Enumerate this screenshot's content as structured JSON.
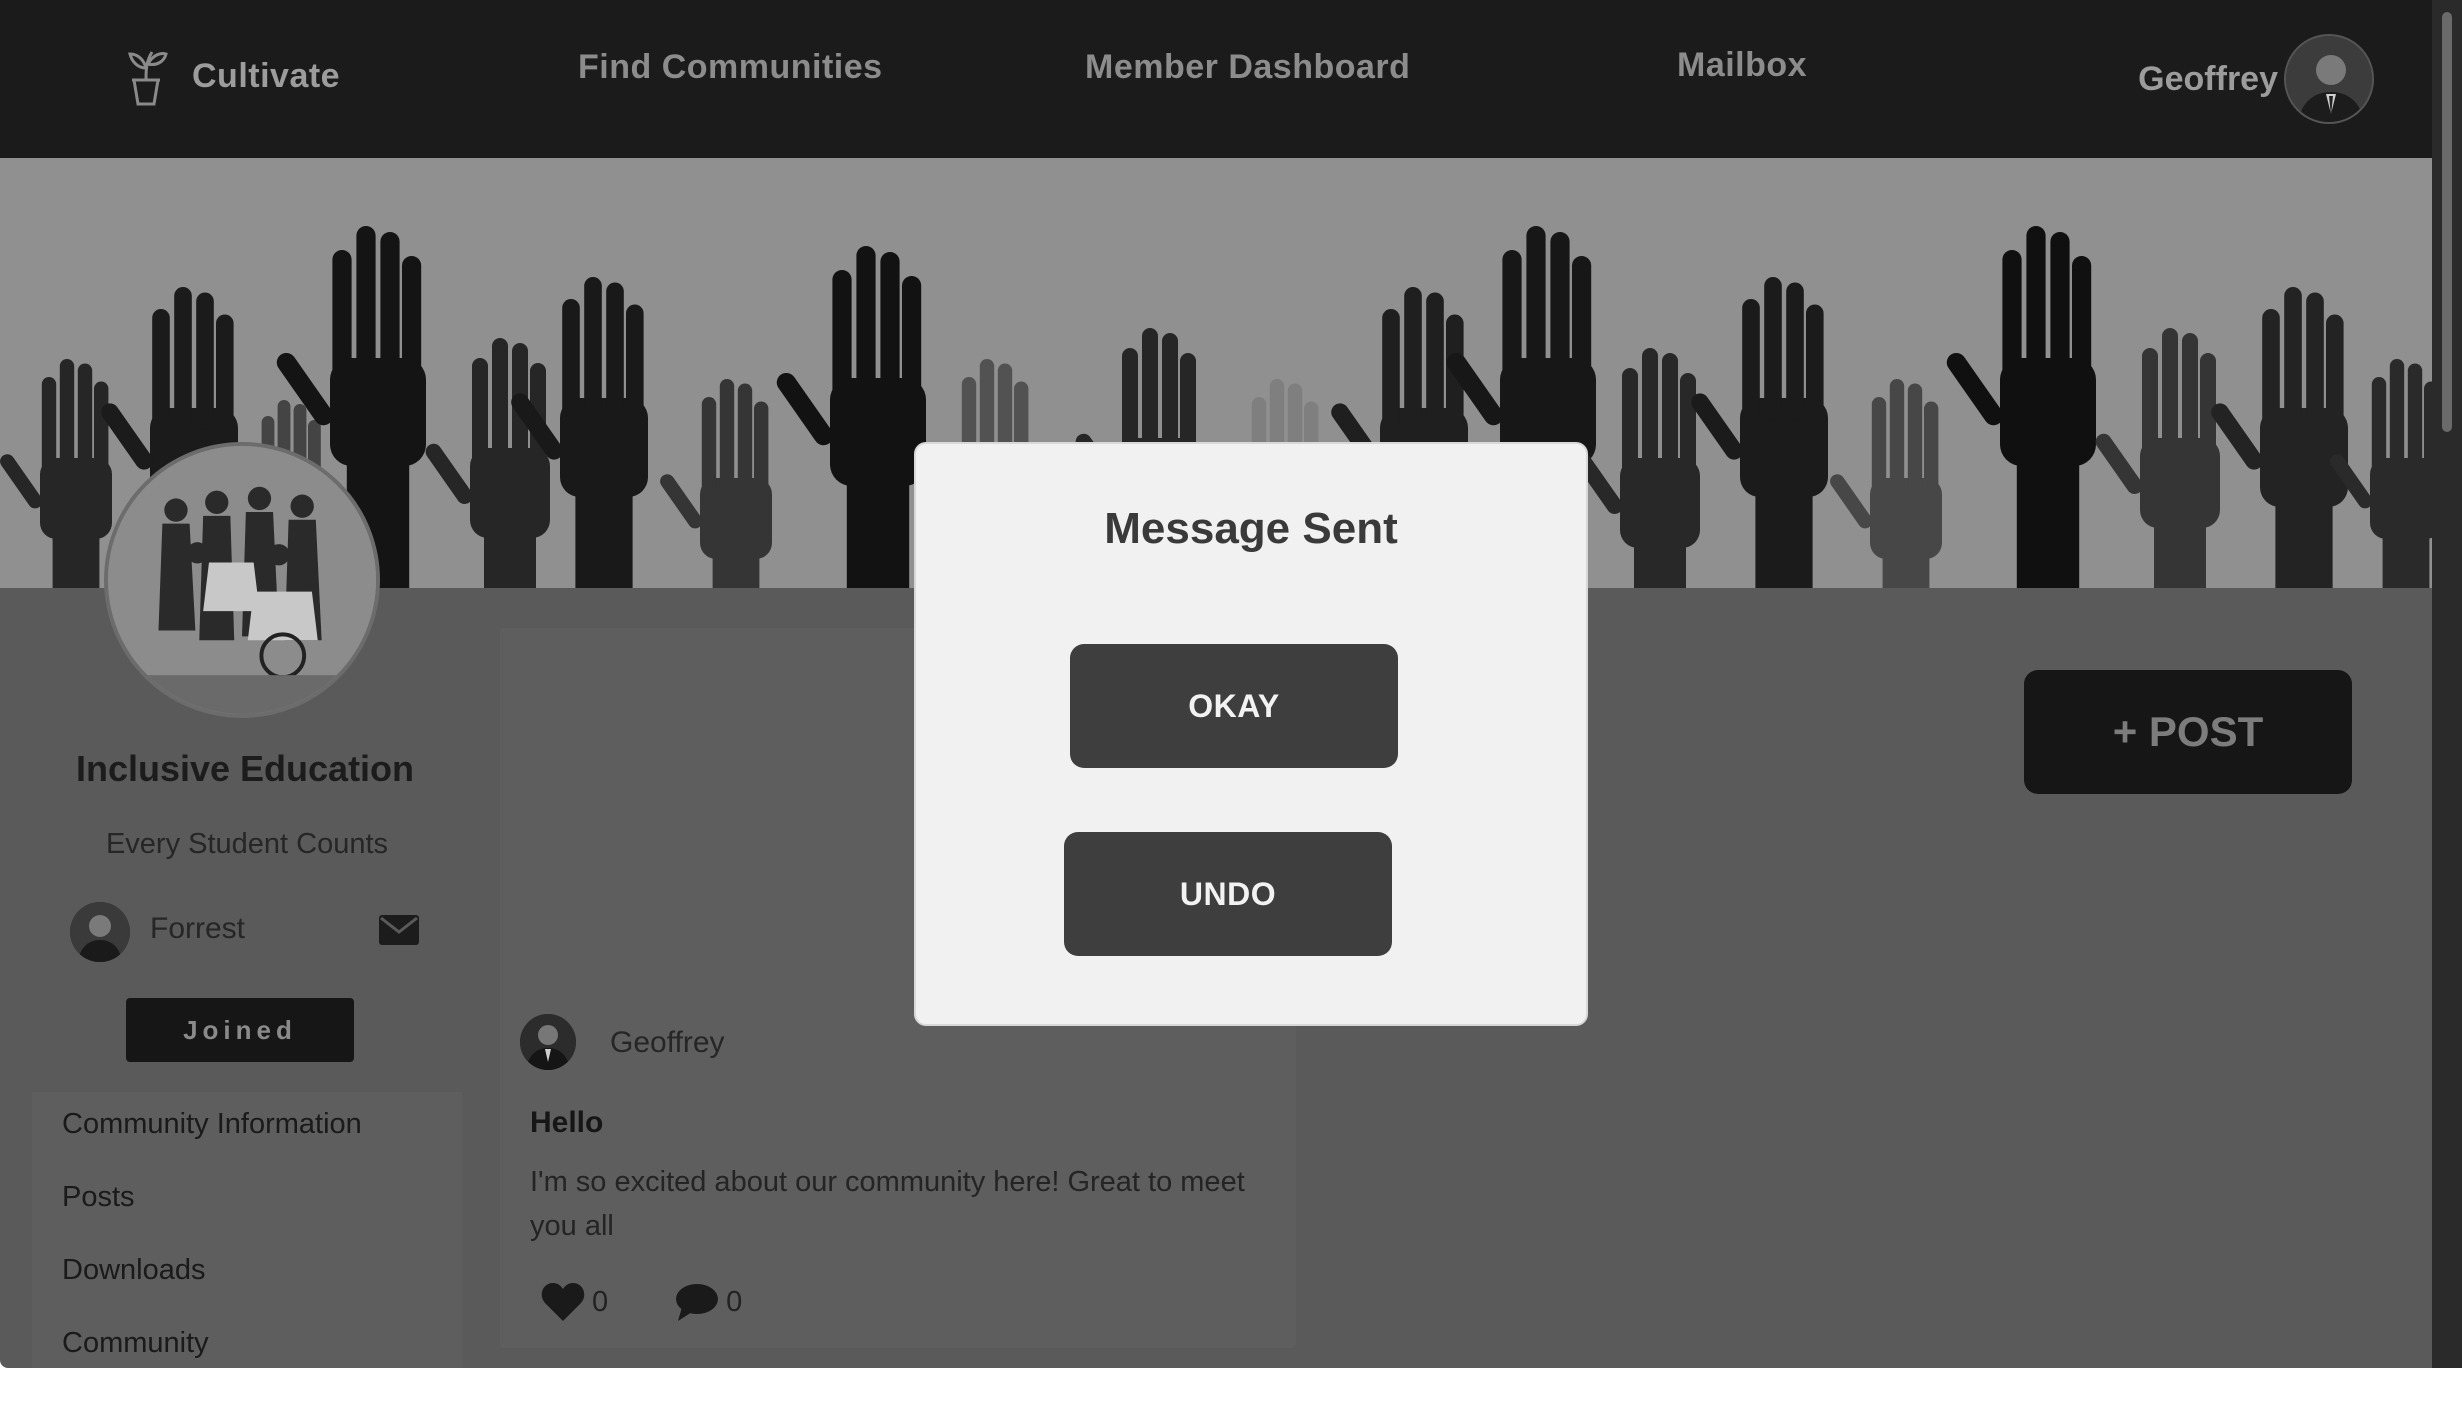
{
  "nav": {
    "brand_label": "Cultivate",
    "brand_icon": "plant-pot-icon",
    "links": [
      "Find Communities",
      "Member Dashboard",
      "Mailbox"
    ],
    "user_name": "Geoffrey"
  },
  "community": {
    "name": "Inclusive Education",
    "tagline": "Every Student Counts",
    "owner_name": "Forrest",
    "joined_label": "Joined",
    "menu": [
      "Community Information",
      "Posts",
      "Downloads",
      "Community"
    ]
  },
  "post": {
    "author": "Geoffrey",
    "title": "Hello",
    "body": "I'm so excited about our community here! Great to meet you all",
    "likes": "0",
    "comments": "0"
  },
  "post_button_label": "+ POST",
  "modal": {
    "title": "Message Sent",
    "okay_label": "OKAY",
    "undo_label": "UNDO"
  },
  "colors": {
    "navbar": "#1b1b1b",
    "page_overlay": "#5a5a5a",
    "modal_bg": "#f1f1f1",
    "modal_button": "#3e3e3e"
  }
}
